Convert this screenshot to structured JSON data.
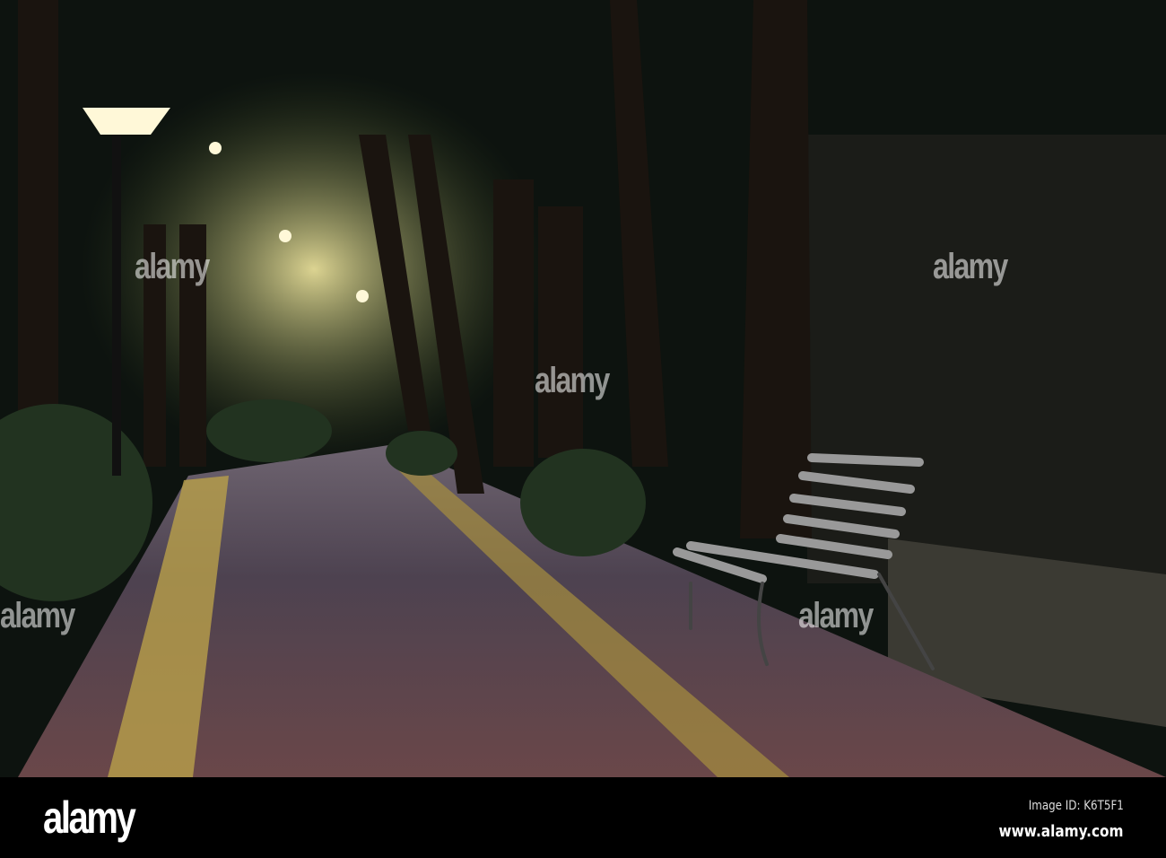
{
  "photo": {
    "subject": "night park path with bench and street lamps",
    "watermark": "alamy"
  },
  "footer": {
    "logo": "alamy",
    "image_id": "Image ID: K6T5F1",
    "website": "www.alamy.com"
  },
  "colors": {
    "background": "#000000",
    "path": "#5a4548",
    "stripe": "#b9a04a",
    "lamp": "#fff8d8"
  }
}
